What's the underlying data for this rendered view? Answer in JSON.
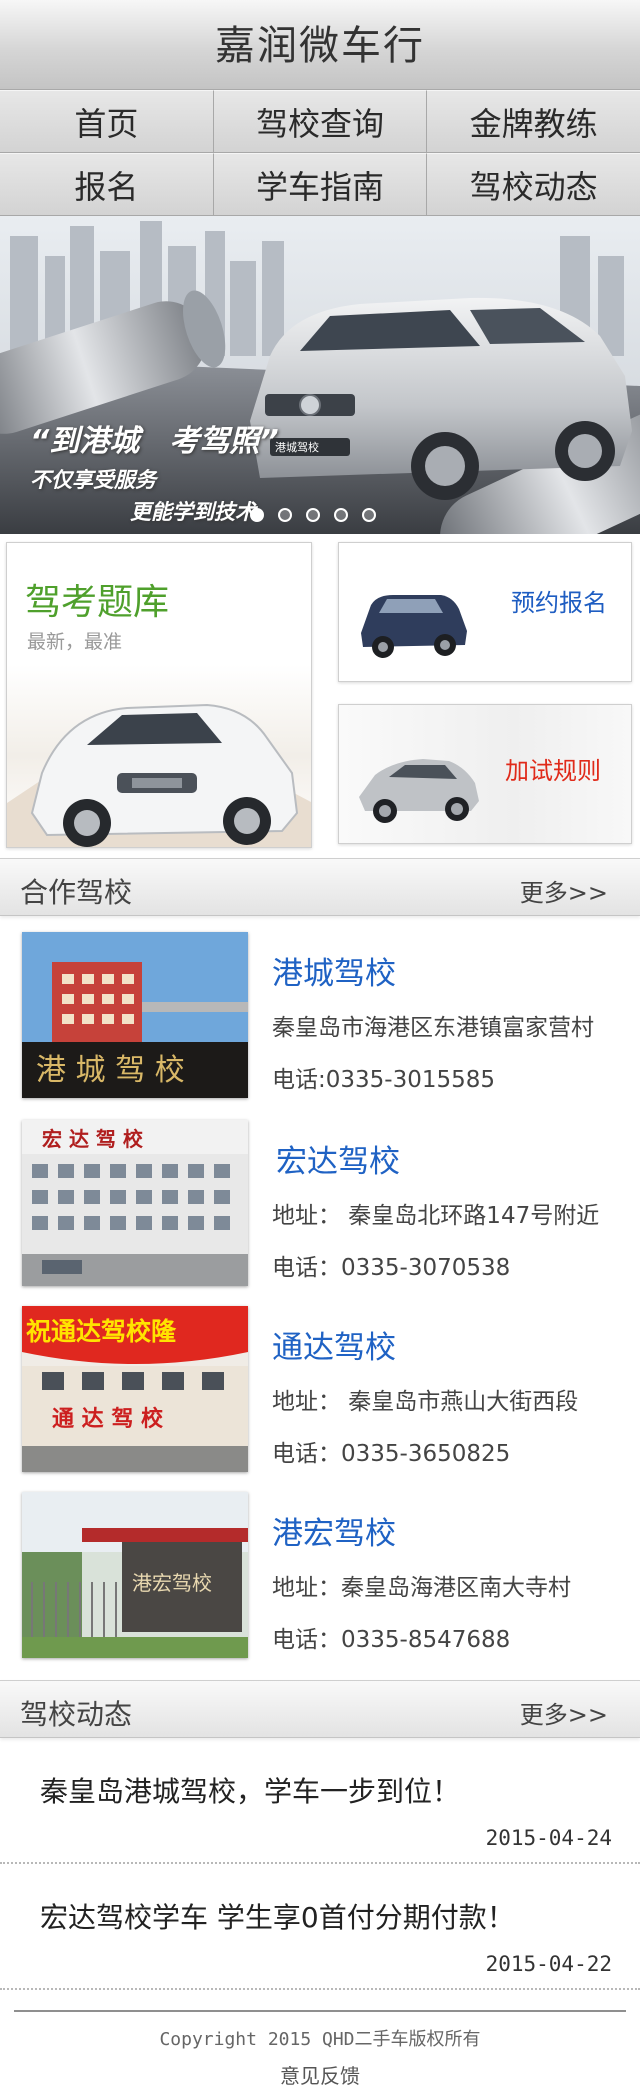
{
  "header": {
    "title": "嘉润微车行"
  },
  "nav": {
    "rows": [
      [
        "首页",
        "驾校查询",
        "金牌教练"
      ],
      [
        "报名",
        "学车指南",
        "驾校动态"
      ]
    ]
  },
  "banner": {
    "tagline": "“到港城　考驾照”",
    "sub1": "不仅享受服务",
    "sub2": "更能学到技术",
    "plate": "港城驾校",
    "slides": 5,
    "active_slide": 1
  },
  "cards": {
    "exam_bank": {
      "title": "驾考题库",
      "subtitle": "最新，最准"
    },
    "signup": {
      "label": "预约报名"
    },
    "rules": {
      "label": "加试规则"
    }
  },
  "partners": {
    "title": "合作驾校",
    "more": "更多>>",
    "schools": [
      {
        "name": "港城驾校",
        "address": "秦皇岛市海港区东港镇富家营村",
        "phone": "电话:0335-3015585",
        "sign": "港 城 驾 校"
      },
      {
        "name": "宏达驾校",
        "address": "地址：  秦皇岛北环路147号附近",
        "phone": "电话：0335-3070538",
        "sign": "宏 达 驾 校"
      },
      {
        "name": "通达驾校",
        "address": "地址：  秦皇岛市燕山大街西段",
        "phone": "电话：0335-3650825",
        "sign": "祝通达驾校隆",
        "sign2": "通 达 驾 校"
      },
      {
        "name": "港宏驾校",
        "address": "地址：秦皇岛海港区南大寺村",
        "phone": "电话：0335-8547688",
        "sign": "港宏驾校"
      }
    ]
  },
  "news": {
    "title": "驾校动态",
    "more": "更多>>",
    "items": [
      {
        "title": "秦皇岛港城驾校，学车一步到位！",
        "date": "2015-04-24"
      },
      {
        "title": "宏达驾校学车  学生享0首付分期付款！",
        "date": "2015-04-22"
      }
    ]
  },
  "footer": {
    "copyright": "Copyright  2015 QHD二手车版权所有",
    "feedback": "意见反馈"
  },
  "colors": {
    "school_name": "#1f62c4",
    "exam_title": "#4fa02c",
    "signup_label": "#1e5dc2",
    "rules_label": "#e02a1a"
  }
}
